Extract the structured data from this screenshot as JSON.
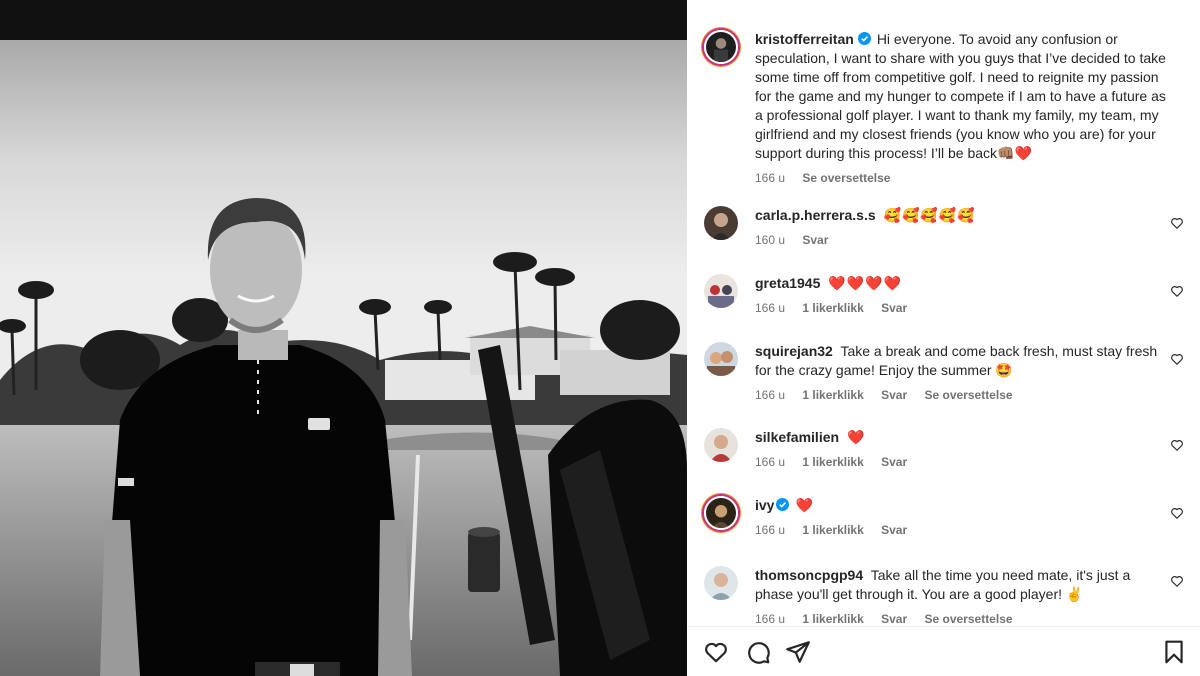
{
  "post": {
    "author": "kristofferreitan",
    "caption": "Hi everyone. To avoid any confusion or speculation, I want to share with you guys that I’ve decided to take some time off from competitive golf. I need to reignite my passion for the game and my hunger to compete if I am to have a future as a professional golf player. I want to thank my family, my team, my girlfriend and my closest friends (you know who you are) for your support during this process! I’ll be back👊🏽❤️",
    "time": "166 u",
    "translate": "Se oversettelse"
  },
  "comments": [
    {
      "user": "carla.p.herrera.s.s",
      "text": "🥰🥰🥰🥰🥰",
      "time": "160 u",
      "likes": "",
      "reply": "Svar",
      "translate": ""
    },
    {
      "user": "greta1945",
      "text": "❤️❤️❤️❤️",
      "time": "166 u",
      "likes": "1 likerklikk",
      "reply": "Svar",
      "translate": ""
    },
    {
      "user": "squirejan32",
      "text": "Take a break and come back fresh, must stay fresh for the crazy game! Enjoy the summer 🤩",
      "time": "166 u",
      "likes": "1 likerklikk",
      "reply": "Svar",
      "translate": "Se oversettelse"
    },
    {
      "user": "silkefamilien",
      "text": "❤️",
      "time": "166 u",
      "likes": "1 likerklikk",
      "reply": "Svar",
      "translate": ""
    },
    {
      "user": "ivy",
      "text": "❤️",
      "time": "166 u",
      "likes": "1 likerklikk",
      "reply": "Svar",
      "translate": ""
    },
    {
      "user": "thomsoncpgp94",
      "text": "Take all the time you need mate, it's just a phase you'll get through it. You are a good player! ✌️",
      "time": "166 u",
      "likes": "1 likerklikk",
      "reply": "Svar",
      "translate": "Se oversettelse"
    }
  ],
  "icons": {
    "like": "heart-icon",
    "comment": "comment-icon",
    "share": "share-icon",
    "save": "bookmark-icon",
    "verified": "verified-badge-icon"
  },
  "colors": {
    "verified": "#0095f6",
    "meta_text": "#737373",
    "text": "#262626"
  }
}
